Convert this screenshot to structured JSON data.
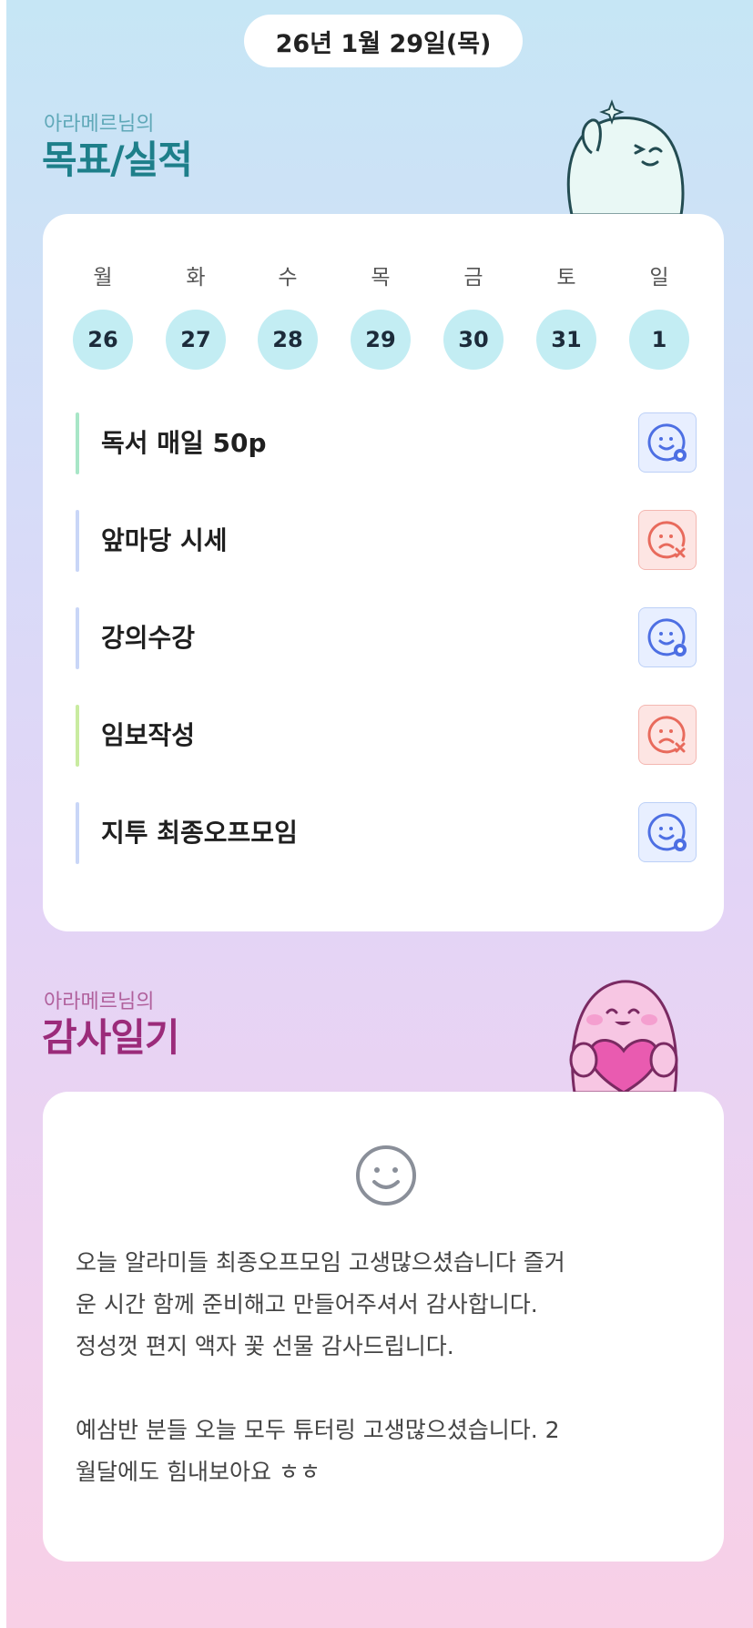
{
  "header": {
    "date": "26년 1월 29일(목)"
  },
  "goals": {
    "subtitle": "아라메르님의",
    "title": "목표/실적",
    "weekdays": [
      "월",
      "화",
      "수",
      "목",
      "금",
      "토",
      "일"
    ],
    "dates": [
      "26",
      "27",
      "28",
      "29",
      "30",
      "31",
      "1"
    ],
    "items": [
      {
        "label": "독서 매일 50p",
        "status": "success",
        "bar_color": "#a8e6c7"
      },
      {
        "label": "앞마당 시세",
        "status": "fail",
        "bar_color": "#c9d6f7"
      },
      {
        "label": "강의수강",
        "status": "success",
        "bar_color": "#c9d6f7"
      },
      {
        "label": "임보작성",
        "status": "fail",
        "bar_color": "#c9eba0"
      },
      {
        "label": "지투 최종오프모임",
        "status": "success",
        "bar_color": "#c9d6f7"
      }
    ]
  },
  "gratitude": {
    "subtitle": "아라메르님의",
    "title": "감사일기",
    "mood_icon": "smile-face-icon",
    "lines": [
      "오늘 알라미들 최종오프모임 고생많으셨습니다 즐거",
      "운 시간 함께 준비해고 만들어주셔서 감사합니다.",
      "정성껏 편지 액자 꽃 선물 감사드립니다.",
      "",
      "예삼반 분들 오늘 모두 튜터링 고생많으셨습니다. 2",
      "월달에도 힘내보아요 ㅎㅎ"
    ]
  },
  "colors": {
    "success_icon": "#4d6fe3",
    "fail_icon": "#e86a5c",
    "date_circle": "#c3edf3"
  }
}
